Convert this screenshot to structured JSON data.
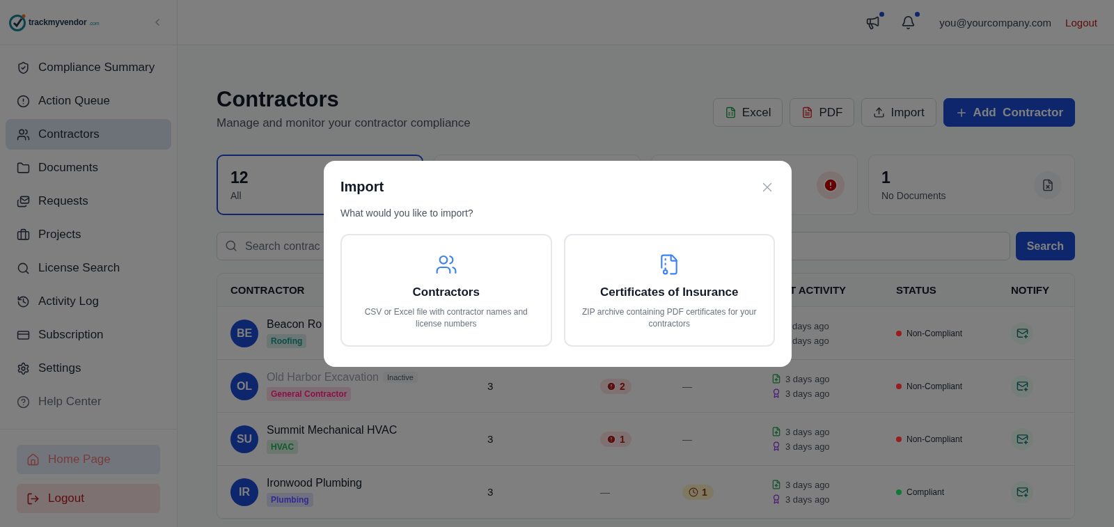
{
  "sidebar": {
    "logo": {
      "text": "trackmyvendor",
      "suffix": ".com"
    },
    "items": [
      {
        "label": "Compliance Summary",
        "kind": "shield",
        "selected": false,
        "muted": false
      },
      {
        "label": "Action Queue",
        "kind": "alert",
        "selected": false,
        "muted": false
      },
      {
        "label": "Contractors",
        "kind": "users",
        "selected": true,
        "muted": false
      },
      {
        "label": "Documents",
        "kind": "folder",
        "selected": false,
        "muted": false
      },
      {
        "label": "Requests",
        "kind": "mail",
        "selected": false,
        "muted": false
      },
      {
        "label": "Projects",
        "kind": "briefcase",
        "selected": false,
        "muted": false
      },
      {
        "label": "License Search",
        "kind": "search",
        "selected": false,
        "muted": false
      },
      {
        "label": "Activity Log",
        "kind": "history",
        "selected": false,
        "muted": false
      },
      {
        "label": "Subscription",
        "kind": "card",
        "selected": false,
        "muted": false
      },
      {
        "label": "Settings",
        "kind": "settings",
        "selected": false,
        "muted": false
      },
      {
        "label": "Help Center",
        "kind": "help",
        "selected": false,
        "muted": true
      }
    ],
    "footer": [
      {
        "label": "Home Page",
        "kind": "home"
      },
      {
        "label": "Logout",
        "kind": "logout"
      }
    ]
  },
  "topbar": {
    "icons": [
      {
        "kind": "megaphone",
        "unread": true
      },
      {
        "kind": "bell",
        "unread": true
      }
    ],
    "email": "you@yourcompany.com",
    "logout": "Logout"
  },
  "page": {
    "title": "Contractors",
    "subtitle": "Manage and monitor your contractor compliance",
    "actions": [
      {
        "label": "Excel",
        "kind": "excel"
      },
      {
        "label": "PDF",
        "kind": "pdf"
      },
      {
        "label": "Import",
        "kind": "import"
      },
      {
        "label": "Add  Contractor",
        "kind": "add"
      }
    ]
  },
  "stats": [
    {
      "value": "12",
      "label": "All",
      "kind": "all",
      "selected": true
    },
    {
      "kind": "plain",
      "selected": false
    },
    {
      "kind": "alert",
      "selected": false
    },
    {
      "value": "1",
      "label": "No Documents",
      "kind": "no_documents",
      "selected": false
    }
  ],
  "search": {
    "placeholder": "Search contrac",
    "button": "Search"
  },
  "table": {
    "header": {
      "contractor": "CONTRACTOR",
      "last_activity": "T ACTIVITY",
      "status": "STATUS",
      "notify": "NOTIFY"
    },
    "rows": [
      {
        "initials": "BE",
        "name": "Beacon Ro",
        "inactive": false,
        "tag": {
          "text": "Roofing",
          "color": "#0b4f4a"
        },
        "activity": [
          {
            "text": "days ago"
          },
          {
            "text": "days ago"
          }
        ],
        "status": {
          "text": "Non-Compliant",
          "color": "#9b1c1c"
        }
      },
      {
        "initials": "OL",
        "name": "Old Harbor Excavation",
        "inactive": true,
        "badge": "Inactive",
        "tag": {
          "text": "General Contractor",
          "color": "#8a1245"
        },
        "column_2": "3",
        "column_3": {
          "kind": "alert",
          "text": "2"
        },
        "column_4": {
          "kind": "dash",
          "text": "—"
        },
        "activity": [
          {
            "kind": "upload",
            "text": "3 days ago"
          },
          {
            "kind": "award",
            "text": "3 days ago"
          }
        ],
        "status": {
          "text": "Non-Compliant",
          "color": "#9b1c1c"
        }
      },
      {
        "initials": "SU",
        "name": "Summit Mechanical HVAC",
        "inactive": false,
        "tag": {
          "text": "HVAC",
          "color": "#0f5a2c"
        },
        "column_2": "3",
        "column_3": {
          "kind": "alert",
          "text": "1"
        },
        "column_4": {
          "kind": "dash",
          "text": "—"
        },
        "activity": [
          {
            "kind": "upload",
            "text": "3 days ago"
          },
          {
            "kind": "award",
            "text": "3 days ago"
          }
        ],
        "status": {
          "text": "Non-Compliant",
          "color": "#9b1c1c"
        }
      },
      {
        "initials": "IR",
        "name": "Ironwood Plumbing",
        "inactive": false,
        "tag": {
          "text": "Plumbing",
          "color": "#312a8f"
        },
        "column_2": "3",
        "column_3": {
          "kind": "dash",
          "text": "—"
        },
        "column_4": {
          "kind": "pending",
          "text": "1"
        },
        "activity": [
          {
            "kind": "upload",
            "text": "3 days ago"
          },
          {
            "kind": "award",
            "text": "3 days ago"
          }
        ],
        "status": {
          "text": "Compliant",
          "color": "#0f7a33"
        }
      }
    ]
  },
  "modal": {
    "title": "Import",
    "prompt": "What would you like to import?",
    "options": [
      {
        "kind": "contractors",
        "title": "Contractors",
        "description": "CSV or Excel file with contractor names and license numbers"
      },
      {
        "kind": "certificates",
        "title": "Certificates of Insurance",
        "description": "ZIP archive containing PDF certificates for your contractors"
      }
    ]
  }
}
